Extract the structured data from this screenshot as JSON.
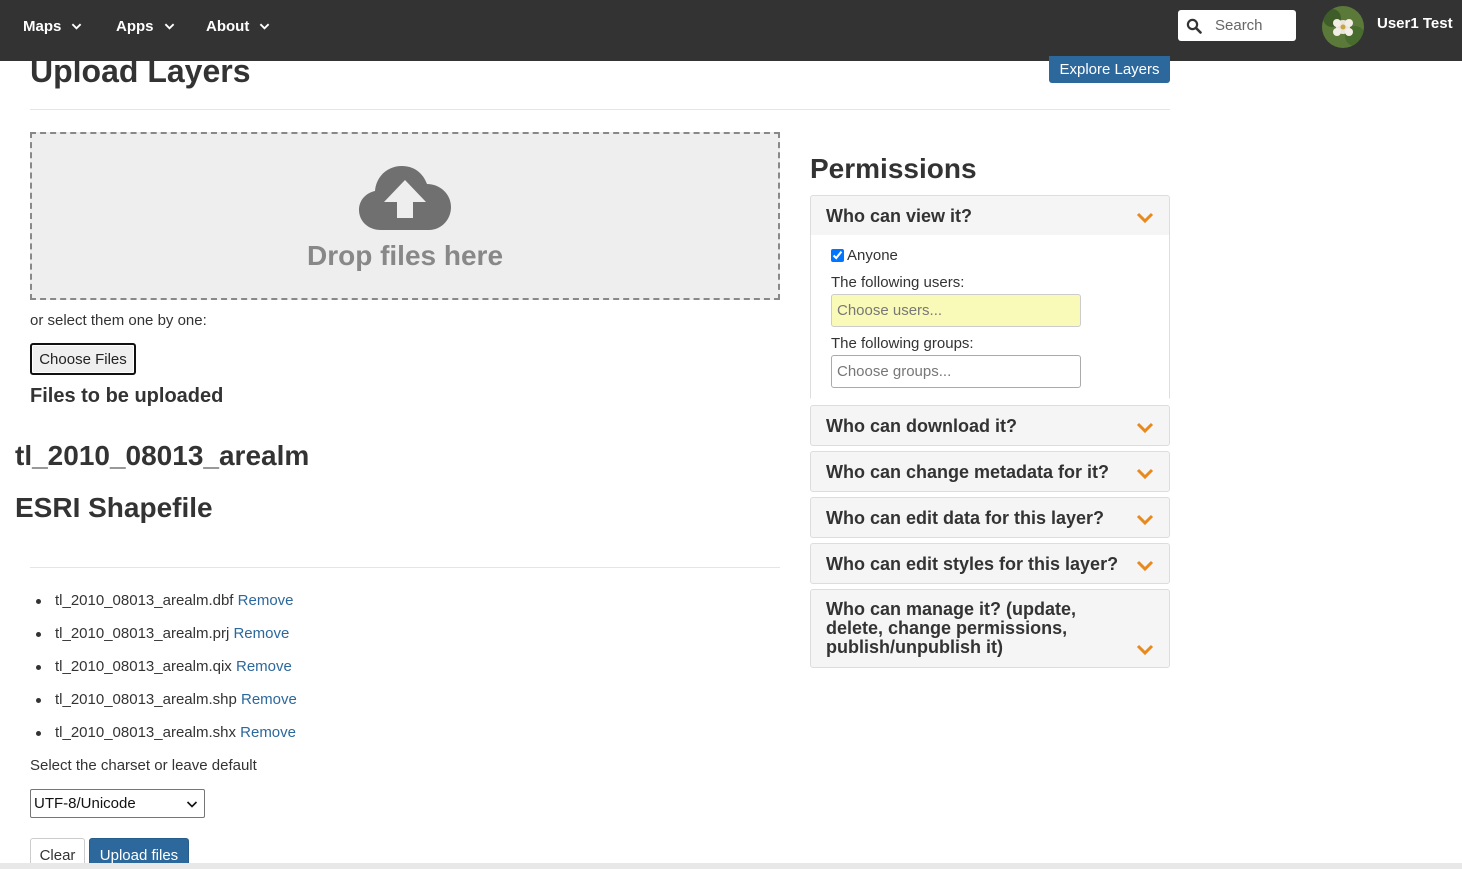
{
  "nav": {
    "maps": "Maps",
    "apps": "Apps",
    "about": "About",
    "search_placeholder": "Search",
    "username": "User1 Test"
  },
  "header": {
    "title": "Upload Layers",
    "explore_button": "Explore Layers"
  },
  "upload": {
    "drop_text": "Drop files here",
    "select_text": "or select them one by one:",
    "choose_button": "Choose Files",
    "files_heading": "Files to be uploaded",
    "layer_name": "tl_2010_08013_arealm",
    "layer_type": "ESRI Shapefile",
    "files": [
      {
        "name": "tl_2010_08013_arealm.dbf",
        "action": "Remove"
      },
      {
        "name": "tl_2010_08013_arealm.prj",
        "action": "Remove"
      },
      {
        "name": "tl_2010_08013_arealm.qix",
        "action": "Remove"
      },
      {
        "name": "tl_2010_08013_arealm.shp",
        "action": "Remove"
      },
      {
        "name": "tl_2010_08013_arealm.shx",
        "action": "Remove"
      }
    ],
    "charset_label": "Select the charset or leave default",
    "charset_value": "UTF-8/Unicode",
    "clear_button": "Clear",
    "upload_button": "Upload files"
  },
  "permissions": {
    "title": "Permissions",
    "view": {
      "heading": "Who can view it?",
      "anyone_label": "Anyone",
      "anyone_checked": true,
      "users_label": "The following users:",
      "users_placeholder": "Choose users...",
      "groups_label": "The following groups:",
      "groups_placeholder": "Choose groups..."
    },
    "download": "Who can download it?",
    "change_metadata": "Who can change metadata for it?",
    "edit_data": "Who can edit data for this layer?",
    "edit_styles": "Who can edit styles for this layer?",
    "manage": "Who can manage it? (update, delete, change permissions, publish/unpublish it)"
  },
  "colors": {
    "navbar": "#333333",
    "primary": "#2c689c",
    "caret": "#e8891d",
    "users_input_bg": "#fafab8"
  }
}
